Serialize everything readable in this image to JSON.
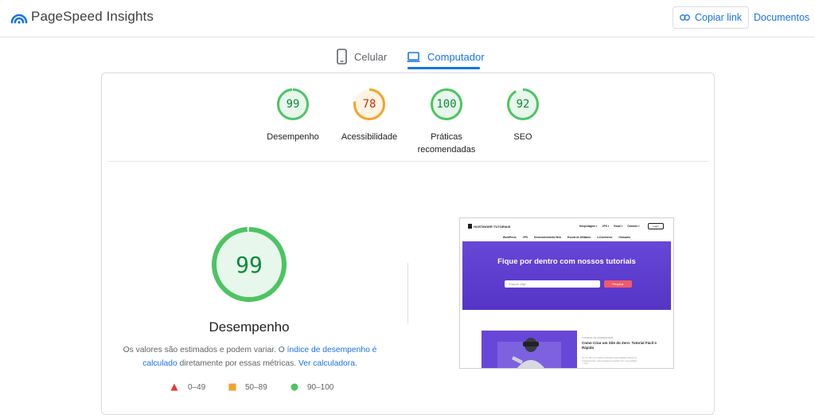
{
  "header": {
    "app_title": "PageSpeed Insights",
    "copy_link_label": "Copiar link",
    "docs_label": "Documentos"
  },
  "tabs": [
    {
      "label": "Celular",
      "icon": "smartphone-icon",
      "active": false
    },
    {
      "label": "Computador",
      "icon": "laptop-icon",
      "active": true
    }
  ],
  "scores": [
    {
      "value": "99",
      "label": "Desempenho",
      "status": "pass"
    },
    {
      "value": "78",
      "label": "Acessibilidade",
      "status": "average"
    },
    {
      "value": "100",
      "label": "Práticas recomendadas",
      "status": "pass"
    },
    {
      "value": "92",
      "label": "SEO",
      "status": "pass"
    }
  ],
  "performance": {
    "score": "99",
    "title": "Desempenho",
    "desc_part1": "Os valores são estimados e podem variar. O ",
    "desc_link1": "índice de desempenho é calculado",
    "desc_part2": " diretamente por essas métricas. ",
    "desc_link2": "Ver calculadora."
  },
  "legend": [
    {
      "range": "0–49",
      "shape": "triangle",
      "color": "#e53935"
    },
    {
      "range": "50–89",
      "shape": "square",
      "color": "#f4a32a"
    },
    {
      "range": "90–100",
      "shape": "circle",
      "color": "#4cc462"
    }
  ],
  "colors": {
    "pass": "#0d8a3a",
    "pass_ring": "#4cc462",
    "pass_fill": "#e8f7ec",
    "average": "#c33300",
    "average_ring": "#f4a32a",
    "average_fill": "#fff3e3",
    "accent": "#1a73e8"
  },
  "screenshot": {
    "brand": "HOSTINGER TUTORIAIS",
    "menu": [
      "Hospedagem ▾",
      "VPS ▾",
      "Email ▾",
      "Domínio ▾"
    ],
    "login": "Login",
    "sub_menu": [
      "WordPress",
      "VPS",
      "Desenvolvimento Web",
      "Escola de Afiliados",
      "e-Commerce",
      "Glossário"
    ],
    "hero_title": "Fique por dentro com nossos tutoriais",
    "search_placeholder": "Pesquise artigo",
    "search_button": "Pesquisar",
    "article_tag": "TUTORIAL DE HOSPEDAGEM",
    "article_title": "Como Criar um Site do Zero: Tutorial Fácil e Rápido",
    "article_excerpt": "Ter um site é um passo importante para qualquer pessoa ou empresa online, pois te ajuda a encontrar com o seu público — leia..."
  }
}
